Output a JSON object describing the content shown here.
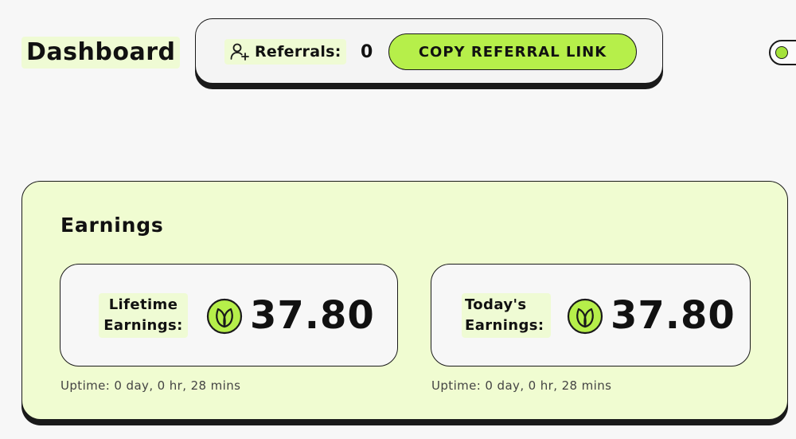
{
  "header": {
    "title": "Dashboard"
  },
  "referrals": {
    "icon": "add-user-icon",
    "label": "Referrals:",
    "count": "0",
    "copy_button": "COPY REFERRAL LINK"
  },
  "toggle": {
    "icon": "toggle-switch"
  },
  "earnings": {
    "title": "Earnings",
    "cards": [
      {
        "label_line1": "Lifetime",
        "label_line2": "Earnings:",
        "icon": "leaf-token-icon",
        "value": "37.80",
        "uptime": "Uptime: 0 day, 0 hr, 28 mins"
      },
      {
        "label_line1": "Today's",
        "label_line2": "Earnings:",
        "icon": "leaf-token-icon",
        "value": "37.80",
        "uptime": "Uptime: 0 day, 0 hr, 28 mins"
      }
    ]
  },
  "colors": {
    "accent": "#b6ef4a",
    "panel_bg": "#f0fcd1",
    "highlight": "#effbd4",
    "outline": "#1a1a1a"
  }
}
